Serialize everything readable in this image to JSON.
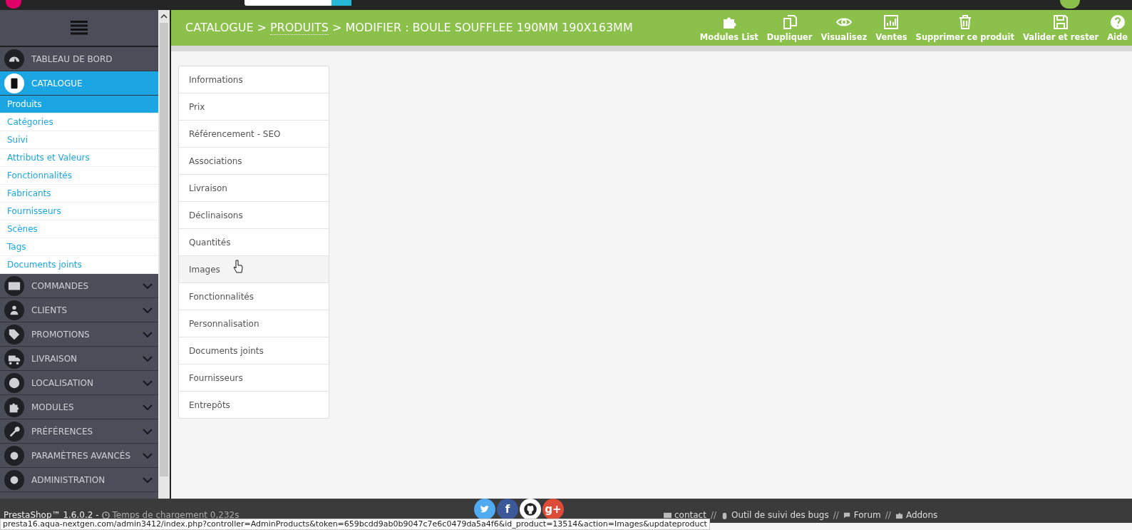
{
  "sidebar": {
    "items": [
      {
        "label": "TABLEAU DE BORD",
        "selected": false,
        "expandable": false
      },
      {
        "label": "CATALOGUE",
        "selected": true,
        "expandable": false,
        "children": [
          {
            "label": "Produits",
            "selected": true
          },
          {
            "label": "Catégories",
            "selected": false
          },
          {
            "label": "Suivi",
            "selected": false
          },
          {
            "label": "Attributs et Valeurs",
            "selected": false
          },
          {
            "label": "Fonctionnalités",
            "selected": false
          },
          {
            "label": "Fabricants",
            "selected": false
          },
          {
            "label": "Fournisseurs",
            "selected": false
          },
          {
            "label": "Scènes",
            "selected": false
          },
          {
            "label": "Tags",
            "selected": false
          },
          {
            "label": "Documents joints",
            "selected": false
          }
        ]
      },
      {
        "label": "COMMANDES",
        "selected": false,
        "expandable": true
      },
      {
        "label": "CLIENTS",
        "selected": false,
        "expandable": true
      },
      {
        "label": "PROMOTIONS",
        "selected": false,
        "expandable": true
      },
      {
        "label": "LIVRAISON",
        "selected": false,
        "expandable": true
      },
      {
        "label": "LOCALISATION",
        "selected": false,
        "expandable": true
      },
      {
        "label": "MODULES",
        "selected": false,
        "expandable": true
      },
      {
        "label": "PRÉFÉRENCES",
        "selected": false,
        "expandable": true
      },
      {
        "label": "PARAMÈTRES AVANCÉS",
        "selected": false,
        "expandable": true
      },
      {
        "label": "ADMINISTRATION",
        "selected": false,
        "expandable": true
      }
    ]
  },
  "breadcrumb": [
    {
      "label": "CATALOGUE",
      "link": false
    },
    {
      "label": ">",
      "link": false
    },
    {
      "label": "PRODUITS",
      "link": true
    },
    {
      "label": "> MODIFIER : BOULE SOUFFLEE 190MM 190X163MM",
      "link": false
    }
  ],
  "toolbar": [
    {
      "label": "Modules List"
    },
    {
      "label": "Dupliquer"
    },
    {
      "label": "Visualisez"
    },
    {
      "label": "Ventes"
    },
    {
      "label": "Supprimer ce produit"
    },
    {
      "label": "Valider et rester"
    },
    {
      "label": "Aide"
    }
  ],
  "tabs": [
    {
      "label": "Informations",
      "selected": false
    },
    {
      "label": "Prix",
      "selected": false
    },
    {
      "label": "Référencement - SEO",
      "selected": false
    },
    {
      "label": "Associations",
      "selected": false
    },
    {
      "label": "Livraison",
      "selected": false
    },
    {
      "label": "Déclinaisons",
      "selected": false
    },
    {
      "label": "Quantités",
      "selected": false
    },
    {
      "label": "Images",
      "selected": true
    },
    {
      "label": "Fonctionnalités",
      "selected": false
    },
    {
      "label": "Personnalisation",
      "selected": false
    },
    {
      "label": "Documents joints",
      "selected": false
    },
    {
      "label": "Fournisseurs",
      "selected": false
    },
    {
      "label": "Entrepôts",
      "selected": false
    }
  ],
  "footer": {
    "version": "PrestaShop™ 1.6.0.2 -",
    "load_time": "Temps de chargement 0,232s",
    "links": [
      {
        "label": "contact"
      },
      {
        "label": "Outil de suivi des bugs"
      },
      {
        "label": "Forum"
      },
      {
        "label": "Addons"
      }
    ],
    "separator": "//",
    "social": [
      {
        "kind": "twitter",
        "color": "#50abf1"
      },
      {
        "kind": "facebook",
        "color": "#3b5998",
        "letter": "f"
      },
      {
        "kind": "github",
        "color": "#ffffff"
      },
      {
        "kind": "google",
        "color": "#dd4b39",
        "letter": "g+"
      }
    ]
  },
  "status_url": "presta16.aqua-nextgen.com/admin3412/index.php?controller=AdminProducts&token=659bcdd9ab0b9047c7e6c0479da5a4f6&id_product=13514&action=Images&updateproduct"
}
